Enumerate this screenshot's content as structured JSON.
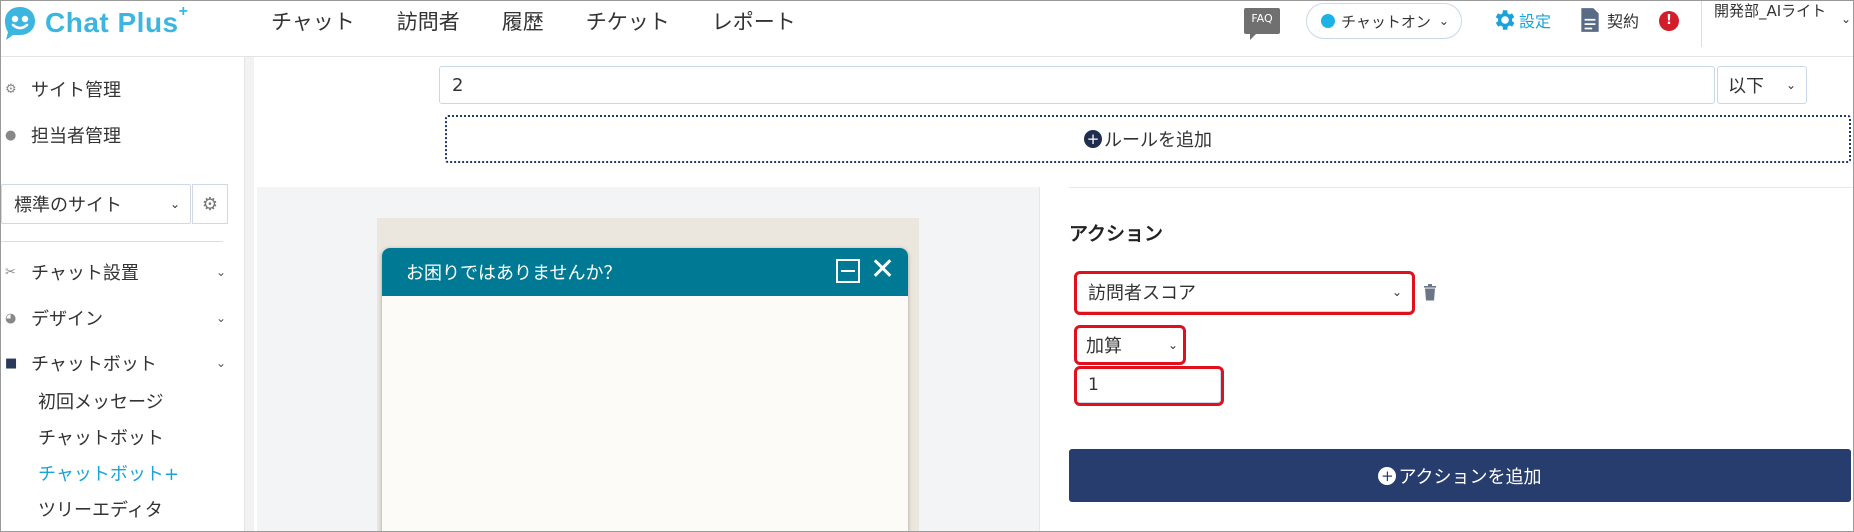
{
  "header": {
    "logo_text": "Chat Plus",
    "logo_sup": "+",
    "nav": [
      "チャット",
      "訪問者",
      "履歴",
      "チケット",
      "レポート"
    ],
    "faq": "FAQ",
    "chat_status": "チャットオン",
    "settings": "設定",
    "contract": "契約",
    "alert": "!",
    "user": "開発部_AIライト"
  },
  "sidebar": {
    "site_admin": "サイト管理",
    "staff_admin": "担当者管理",
    "site_select": "標準のサイト",
    "chat_setup": "チャット設置",
    "design": "デザイン",
    "chatbot": "チャットボット",
    "sub_items": [
      "初回メッセージ",
      "チャットボット",
      "チャットボット+",
      "ツリーエディタ"
    ]
  },
  "rule": {
    "value": "2",
    "comparator": "以下",
    "add_rule": "ルールを追加"
  },
  "preview": {
    "title": "お困りではありませんか？"
  },
  "action": {
    "title": "アクション",
    "type": "訪問者スコア",
    "operation": "加算",
    "value": "1",
    "add_action": "アクションを追加"
  },
  "colors": {
    "brand": "#3cb6e0",
    "chat_header": "#007a94",
    "primary_button": "#263d6e",
    "highlight": "#e0101c"
  }
}
